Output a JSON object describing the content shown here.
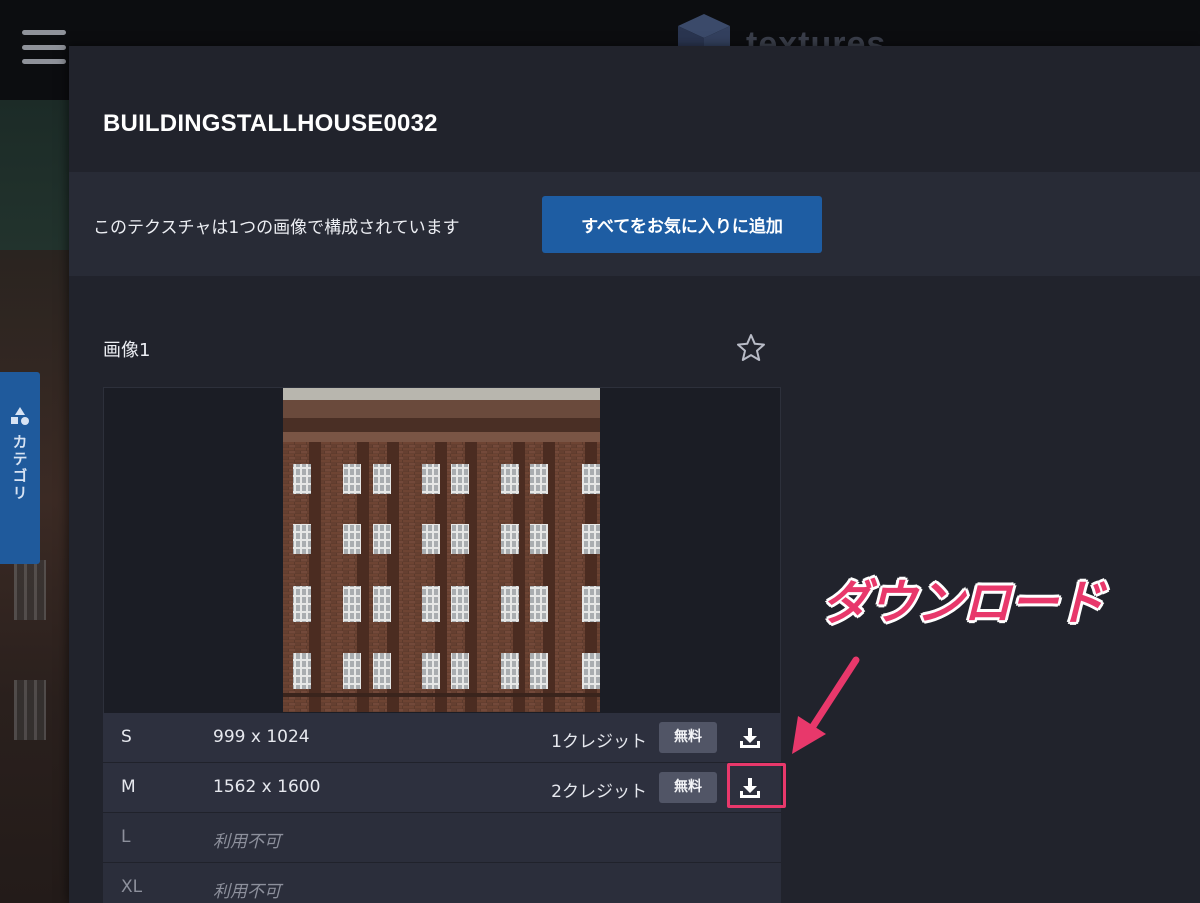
{
  "background": {
    "logo_text": "textures",
    "category_tab_label": "カテゴリ"
  },
  "modal": {
    "title": "BUILDINGSTALLHOUSE0032",
    "info_text": "このテクスチャは1つの画像で構成されています",
    "fav_all_button": "すべてをお気に入りに追加",
    "image_title": "画像1"
  },
  "sizes": [
    {
      "size": "S",
      "resolution": "999 x 1024",
      "credits": "1クレジット",
      "badge": "無料",
      "available": true
    },
    {
      "size": "M",
      "resolution": "1562 x 1600",
      "credits": "2クレジット",
      "badge": "無料",
      "available": true
    },
    {
      "size": "L",
      "resolution": "利用不可",
      "available": false
    },
    {
      "size": "XL",
      "resolution": "利用不可",
      "available": false
    }
  ],
  "annotation": {
    "label": "ダウンロード"
  },
  "colors": {
    "accent_blue": "#1e5da3",
    "annotation_pink": "#e8386b",
    "modal_bg": "#21232c"
  }
}
